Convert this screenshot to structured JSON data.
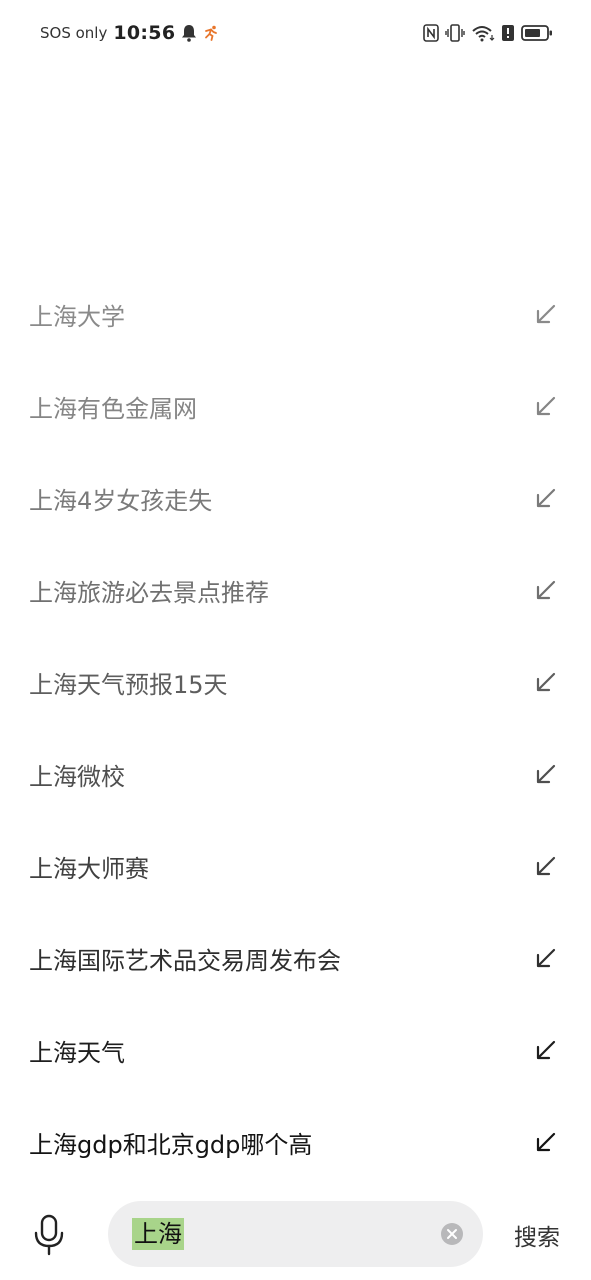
{
  "status_bar": {
    "carrier": "SOS only",
    "time": "10:56"
  },
  "suggestions": [
    {
      "text": "上海大学",
      "color": "#8a8a8a"
    },
    {
      "text": "上海有色金属网",
      "color": "#858585"
    },
    {
      "text": "上海4岁女孩走失",
      "color": "#7a7a7a"
    },
    {
      "text": "上海旅游必去景点推荐",
      "color": "#707070"
    },
    {
      "text": "上海天气预报15天",
      "color": "#5e5e5e"
    },
    {
      "text": "上海微校",
      "color": "#4f4f4f"
    },
    {
      "text": "上海大师赛",
      "color": "#404040"
    },
    {
      "text": "上海国际艺术品交易周发布会",
      "color": "#2e2e2e"
    },
    {
      "text": "上海天气",
      "color": "#1e1e1e"
    },
    {
      "text": "上海gdp和北京gdp哪个高",
      "color": "#141414"
    }
  ],
  "search": {
    "value": "上海",
    "button_label": "搜索"
  },
  "icons": {
    "bell": "bell-icon",
    "fitness": "running-figure-icon",
    "nfc": "nfc-icon",
    "vibrate": "vibrate-icon",
    "wifi": "wifi-icon",
    "alert": "alert-icon",
    "battery": "battery-icon",
    "fill": "arrow-up-left-icon",
    "mic": "microphone-icon",
    "clear": "clear-icon"
  },
  "colors": {
    "highlight": "#a8d48a",
    "field_bg": "#eeeeef",
    "accent_orange": "#e8762c"
  }
}
